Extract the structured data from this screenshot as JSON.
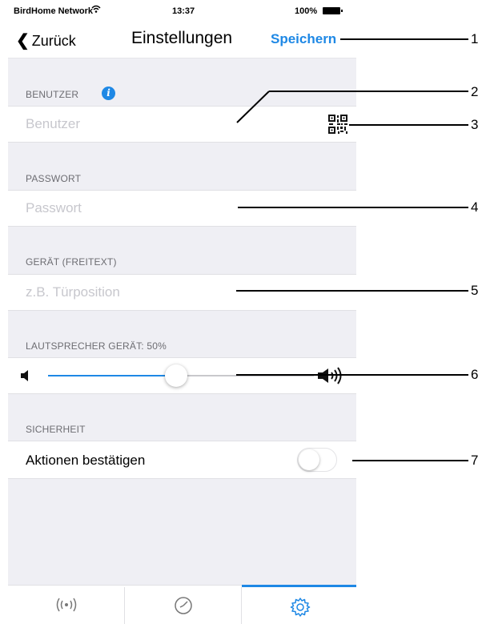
{
  "status_bar": {
    "carrier": "BirdHome Network",
    "time": "13:37",
    "battery": "100%"
  },
  "navbar": {
    "back_label": "Zurück",
    "title": "Einstellungen",
    "save_label": "Speichern"
  },
  "sections": {
    "user": {
      "label": "BENUTZER",
      "placeholder": "Benutzer"
    },
    "password": {
      "label": "PASSWORT",
      "placeholder": "Passwort"
    },
    "device": {
      "label": "GERÄT (FREITEXT)",
      "placeholder": "z.B. Türposition"
    },
    "speaker": {
      "label": "LAUTSPRECHER GERÄT: 50%",
      "value_percent": 50
    },
    "security": {
      "label": "SICHERHEIT",
      "toggle_label": "Aktionen bestätigen",
      "toggle_on": false
    }
  },
  "tabs": [
    {
      "icon": "broadcast-icon",
      "active": false
    },
    {
      "icon": "clock-icon",
      "active": false
    },
    {
      "icon": "gear-icon",
      "active": true
    }
  ],
  "callouts": [
    "1",
    "2",
    "3",
    "4",
    "5",
    "6",
    "7"
  ],
  "colors": {
    "accent": "#1e88e5",
    "background": "#efeff4"
  }
}
